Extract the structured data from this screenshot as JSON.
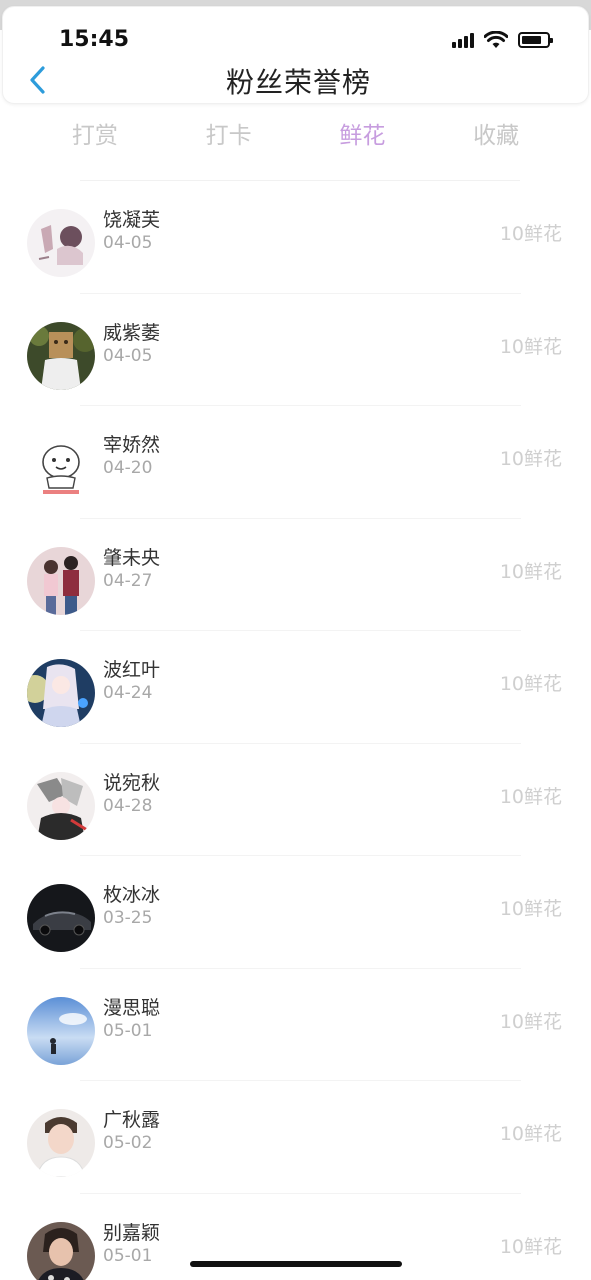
{
  "status": {
    "time": "15:45"
  },
  "header": {
    "title": "粉丝荣誉榜"
  },
  "tabs": [
    {
      "label": "打赏"
    },
    {
      "label": "打卡"
    },
    {
      "label": "鲜花",
      "active": true
    },
    {
      "label": "收藏"
    }
  ],
  "colors": {
    "accent": "#c79ddf",
    "back": "#2d9cdb"
  },
  "items": [
    {
      "name": "饶凝芙",
      "date": "04-05",
      "amount": "10鲜花",
      "avatar_icon": "sketch-person-avatar"
    },
    {
      "name": "威紫萎",
      "date": "04-05",
      "amount": "10鲜花",
      "avatar_icon": "paper-bag-person-avatar"
    },
    {
      "name": "宰娇然",
      "date": "04-20",
      "amount": "10鲜花",
      "avatar_icon": "cartoon-face-avatar"
    },
    {
      "name": "肇未央",
      "date": "04-27",
      "amount": "10鲜花",
      "avatar_icon": "couple-photo-avatar"
    },
    {
      "name": "波红叶",
      "date": "04-24",
      "amount": "10鲜花",
      "avatar_icon": "anime-girl-avatar"
    },
    {
      "name": "说宛秋",
      "date": "04-28",
      "amount": "10鲜花",
      "avatar_icon": "anime-art-avatar"
    },
    {
      "name": "枚冰冰",
      "date": "03-25",
      "amount": "10鲜花",
      "avatar_icon": "car-avatar"
    },
    {
      "name": "漫思聪",
      "date": "05-01",
      "amount": "10鲜花",
      "avatar_icon": "sky-figure-avatar"
    },
    {
      "name": "广秋露",
      "date": "05-02",
      "amount": "10鲜花",
      "avatar_icon": "young-man-avatar"
    },
    {
      "name": "别嘉颖",
      "date": "05-01",
      "amount": "10鲜花",
      "avatar_icon": "portrait-avatar"
    }
  ]
}
